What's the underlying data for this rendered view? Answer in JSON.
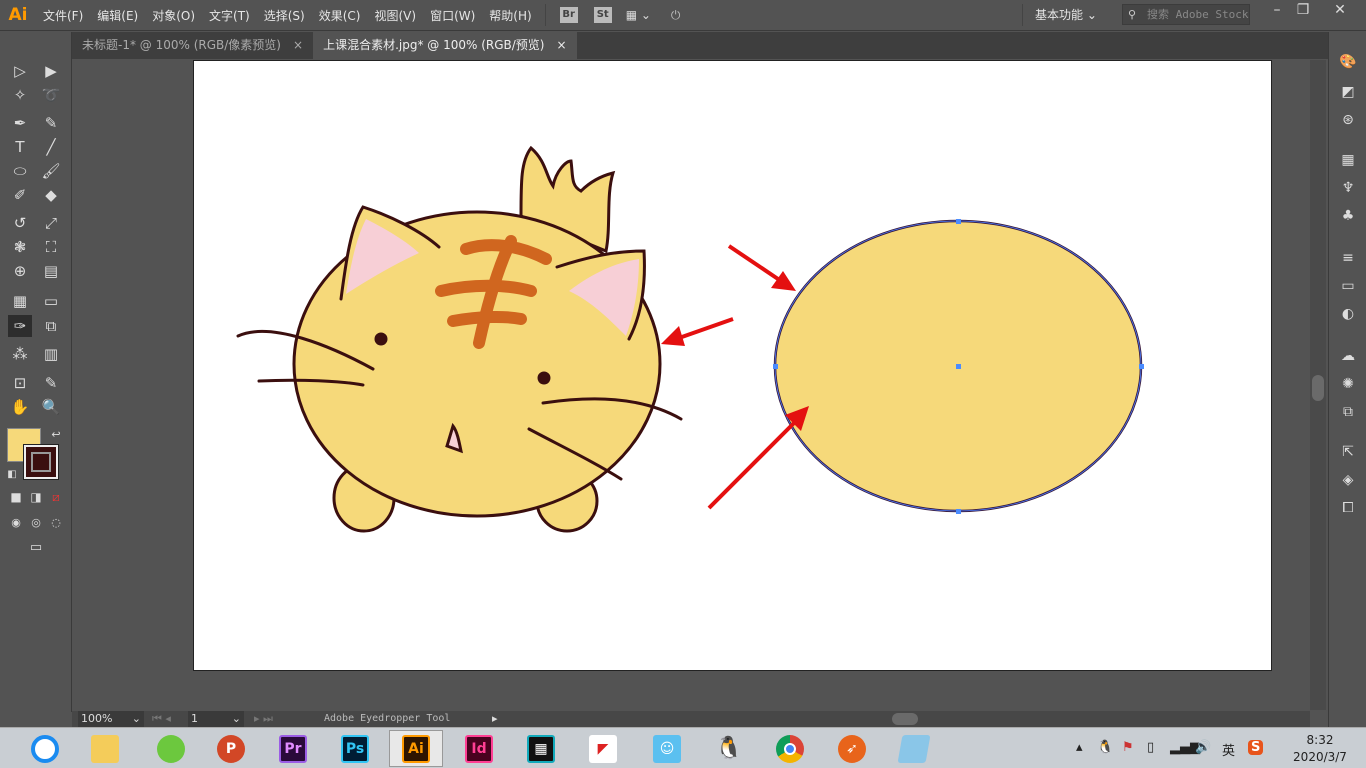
{
  "app": {
    "logo": "Ai"
  },
  "menu": [
    "文件(F)",
    "编辑(E)",
    "对象(O)",
    "文字(T)",
    "选择(S)",
    "效果(C)",
    "视图(V)",
    "窗口(W)",
    "帮助(H)"
  ],
  "menubar_buttons": {
    "bridge": "Br",
    "stock": "St"
  },
  "workspace": "基本功能",
  "search_placeholder": "搜索 Adobe Stock",
  "tabs": [
    {
      "label": "未标题-1* @ 100% (RGB/像素预览)",
      "active": false
    },
    {
      "label": "上课混合素材.jpg* @ 100% (RGB/预览)",
      "active": true
    }
  ],
  "tab_close": "×",
  "colors": {
    "fill": "#f6d97a",
    "stroke": "#3b0f0f",
    "ellipse_stroke": "#3a1a3a",
    "arrow": "#e41010",
    "accent": "#ff9a00"
  },
  "status": {
    "zoom": "100%",
    "page": "1",
    "tool": "Adobe Eyedropper Tool"
  },
  "taskbar_apps": [
    "Browser",
    "File Explorer",
    "WeChat",
    "PowerPoint",
    "Pr",
    "Ps",
    "Ai",
    "Id",
    "Video Editor",
    "Kingsoft",
    "Snipaste",
    "QQ",
    "Chrome",
    "Foxmail",
    "Notes"
  ],
  "tray": {
    "ime": "英",
    "clock_time": "8:32",
    "clock_date": "2020/3/7"
  }
}
